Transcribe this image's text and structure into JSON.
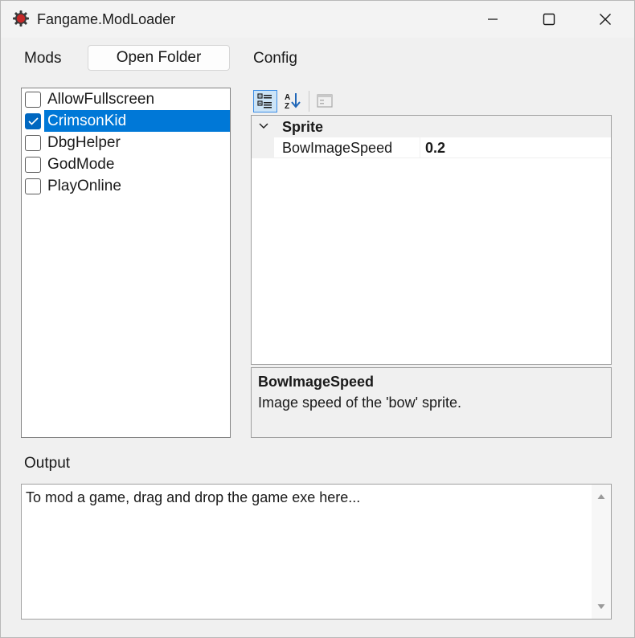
{
  "window": {
    "title": "Fangame.ModLoader",
    "app_icon": "gear-icon",
    "controls": {
      "minimize_icon": "minimize-icon",
      "maximize_icon": "maximize-icon",
      "close_icon": "close-icon"
    }
  },
  "menu": {
    "mods_label": "Mods",
    "open_folder_label": "Open Folder",
    "config_label": "Config"
  },
  "mods": {
    "items": [
      {
        "label": "AllowFullscreen",
        "checked": false,
        "selected": false
      },
      {
        "label": "CrimsonKid",
        "checked": true,
        "selected": true
      },
      {
        "label": "DbgHelper",
        "checked": false,
        "selected": false
      },
      {
        "label": "GodMode",
        "checked": false,
        "selected": false
      },
      {
        "label": "PlayOnline",
        "checked": false,
        "selected": false
      }
    ]
  },
  "property_grid": {
    "toolbar": {
      "categorized_icon": "categorized-view-icon",
      "alphabetical_icon": "sort-alphabetical-icon",
      "property_pages_icon": "property-pages-icon"
    },
    "category": {
      "label": "Sprite",
      "expanded": true
    },
    "properties": [
      {
        "name": "BowImageSpeed",
        "value": "0.2"
      }
    ],
    "description": {
      "title": "BowImageSpeed",
      "text": "Image speed of the 'bow' sprite."
    }
  },
  "output": {
    "label": "Output",
    "text": "To mod a game, drag and drop the game exe here..."
  },
  "colors": {
    "accent": "#0078d7",
    "window_bg": "#f0f0f0",
    "app_icon_red": "#c62828"
  }
}
